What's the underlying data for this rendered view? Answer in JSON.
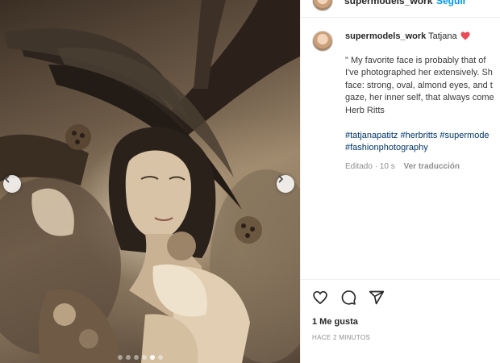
{
  "header": {
    "username": "supermodels_work",
    "separator": "•",
    "follow_label": "Seguir"
  },
  "post": {
    "photo_alt": "Sepia portrait of a woman wearing a large feathered headdress",
    "slide_count": 6,
    "active_slide": 5,
    "caption": {
      "username": "supermodels_work",
      "title": "Tatjana",
      "title_emoji": "heart",
      "quote_lines": [
        "\" My favorite face is probably that of",
        "I've photographed her extensively. Sh",
        "face: strong, oval, almond eyes, and t",
        "gaze, her inner self, that always come",
        "Herb Ritts"
      ],
      "hashtag_lines": [
        "#tatjanapatitz #herbritts #supermode",
        "#fashionphotography"
      ],
      "edited": "Editado · 10 s",
      "translate_label": "Ver traducción"
    },
    "likes": "1 Me gusta",
    "time_ago": "HACE 2 MINUTOS"
  },
  "icons": {
    "like": "heart-icon",
    "comment": "comment-icon",
    "share": "share-icon",
    "prev": "chevron-left-icon",
    "next": "chevron-right-icon"
  },
  "colors": {
    "link_blue": "#0095f6",
    "hashtag": "#00376b",
    "heart_red": "#ed4956",
    "muted": "#8e8e8e"
  }
}
